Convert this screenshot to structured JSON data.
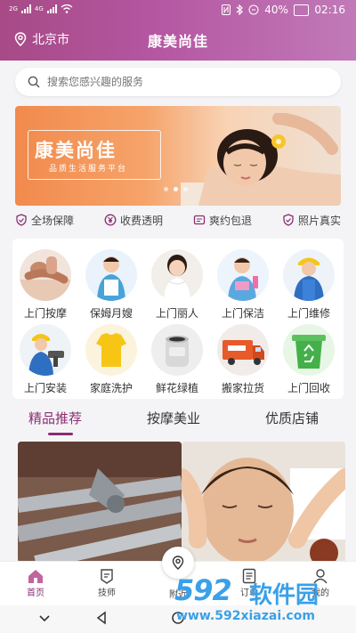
{
  "status_bar": {
    "network_left": "2G",
    "network_right": "4G",
    "battery": "40%",
    "time": "02:16"
  },
  "header": {
    "location": "北京市",
    "title": "康美尚佳"
  },
  "search": {
    "placeholder": "搜索您感兴趣的服务"
  },
  "banner": {
    "brand": "康美尚佳",
    "tagline": "品质生活服务平台",
    "slide_count": 3,
    "active_slide": 1
  },
  "guarantees": [
    {
      "label": "全场保障",
      "icon": "shield-icon"
    },
    {
      "label": "收费透明",
      "icon": "yen-icon"
    },
    {
      "label": "爽约包退",
      "icon": "refund-icon"
    },
    {
      "label": "照片真实",
      "icon": "verified-icon"
    }
  ],
  "services": [
    {
      "label": "上门按摩",
      "icon": "massage-icon"
    },
    {
      "label": "保姆月嫂",
      "icon": "nanny-icon"
    },
    {
      "label": "上门丽人",
      "icon": "beauty-icon"
    },
    {
      "label": "上门保洁",
      "icon": "cleaning-icon"
    },
    {
      "label": "上门维修",
      "icon": "repair-icon"
    },
    {
      "label": "上门安装",
      "icon": "install-icon"
    },
    {
      "label": "家庭洗护",
      "icon": "laundry-icon"
    },
    {
      "label": "鲜花绿植",
      "icon": "plant-icon"
    },
    {
      "label": "搬家拉货",
      "icon": "moving-truck-icon"
    },
    {
      "label": "上门回收",
      "icon": "recycle-icon"
    }
  ],
  "tabs": [
    {
      "label": "精品推荐",
      "active": true
    },
    {
      "label": "按摩美业",
      "active": false
    },
    {
      "label": "优质店铺",
      "active": false
    }
  ],
  "tab_bar": [
    {
      "label": "首页",
      "icon": "home-icon",
      "active": true
    },
    {
      "label": "技师",
      "icon": "technician-icon",
      "active": false
    },
    {
      "label": "附近",
      "icon": "location-pin-icon",
      "active": false
    },
    {
      "label": "订单",
      "icon": "order-icon",
      "active": false
    },
    {
      "label": "我的",
      "icon": "user-icon",
      "active": false
    }
  ],
  "watermark": {
    "number": "592",
    "name": "软件园",
    "url": "www.592xiazai.com"
  },
  "colors": {
    "brand": "#8b2d73",
    "header_gradient_start": "#a74a86",
    "header_gradient_end": "#c17ab8",
    "watermark": "#3aa0e8"
  }
}
